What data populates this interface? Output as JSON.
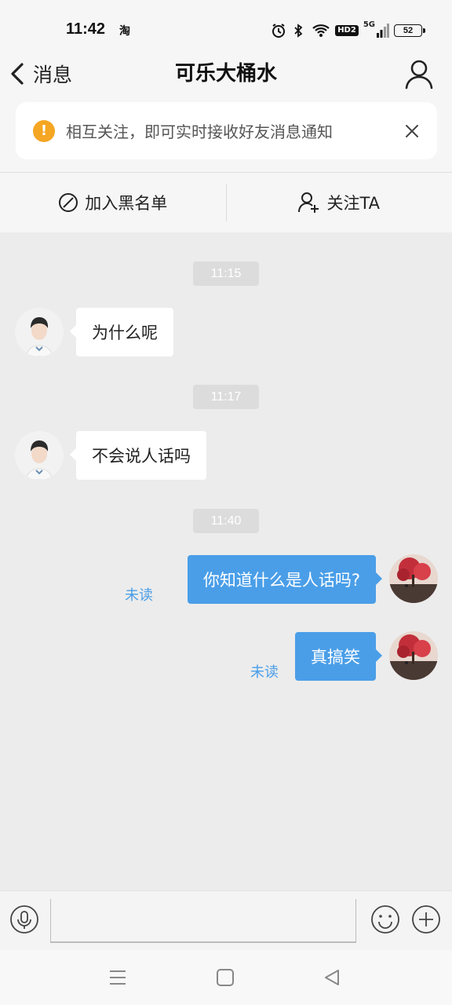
{
  "status_bar": {
    "time": "11:42",
    "app_indicator": "淘",
    "network": "5G",
    "hd_label": "HD2",
    "battery": "52",
    "icons": [
      "alarm-icon",
      "bluetooth-icon",
      "wifi-icon",
      "hd-icon",
      "signal-icon",
      "battery-icon"
    ]
  },
  "header": {
    "back_label": "消息",
    "title": "可乐大桶水",
    "notice_text": "相互关注，即可实时接收好友消息通知",
    "notice_icon": "!"
  },
  "actions": {
    "blacklist_label": "加入黑名单",
    "follow_label": "关注TA"
  },
  "messages": [
    {
      "type": "time",
      "text": "11:15"
    },
    {
      "type": "incoming",
      "text": "为什么呢"
    },
    {
      "type": "time",
      "text": "11:17"
    },
    {
      "type": "incoming",
      "text": "不会说人话吗"
    },
    {
      "type": "time",
      "text": "11:40"
    },
    {
      "type": "outgoing",
      "text": "你知道什么是人话吗?",
      "status": "未读"
    },
    {
      "type": "outgoing",
      "text": "真搞笑",
      "status": "未读"
    }
  ],
  "input": {
    "value": "",
    "placeholder": ""
  },
  "colors": {
    "accent": "#4a9ee8",
    "notice_icon": "#f5a623",
    "chat_bg": "#ececec"
  }
}
